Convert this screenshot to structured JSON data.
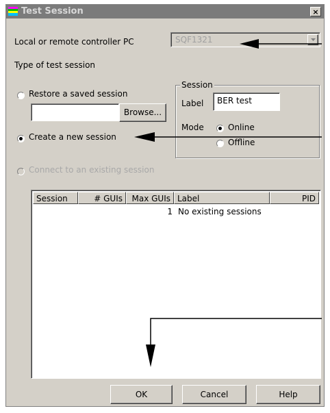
{
  "window": {
    "title": "Test Session",
    "close_glyph": "×"
  },
  "controller": {
    "label": "Local or remote controller PC",
    "value": "SQF1321"
  },
  "type_label": "Type of test session",
  "options": {
    "restore": "Restore a saved session",
    "browse_button": "Browse...",
    "create": "Create a new session",
    "connect": "Connect to an existing session"
  },
  "session_group": {
    "title": "Session",
    "label_caption": "Label",
    "label_value": "BER test",
    "mode_caption": "Mode",
    "online": "Online",
    "offline": "Offline"
  },
  "table": {
    "headers": [
      "Session",
      "# GUIs",
      "Max GUIs",
      "Label",
      "PID"
    ],
    "rows": [
      [
        "",
        "",
        "1",
        "No existing sessions",
        ""
      ]
    ]
  },
  "buttons": {
    "ok": "OK",
    "cancel": "Cancel",
    "help": "Help"
  },
  "icons": [
    "app-icon",
    "close-icon",
    "dropdown-arrow-icon"
  ]
}
